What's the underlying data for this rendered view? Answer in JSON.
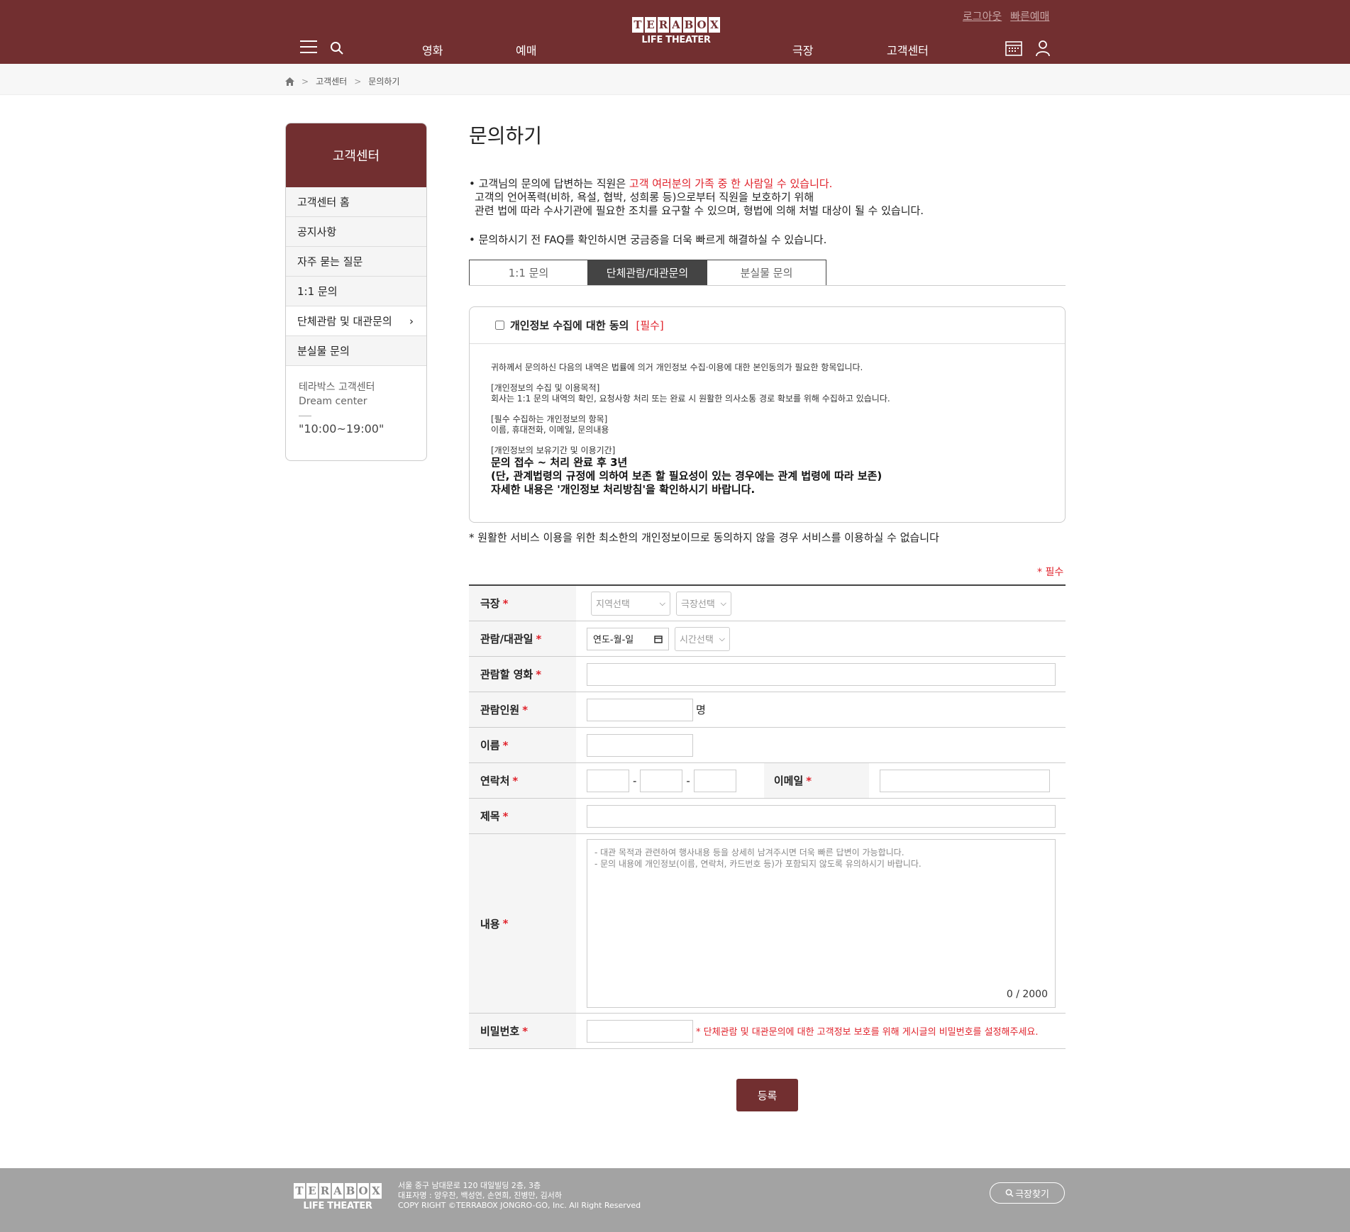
{
  "header": {
    "logo_letters": [
      "T",
      "E",
      "R",
      "A",
      "B",
      "O",
      "X"
    ],
    "logo_sub": "LIFE THEATER",
    "logout": "로그아웃",
    "quick_booking": "빠른예매",
    "nav": [
      "영화",
      "예매",
      "극장",
      "고객센터"
    ],
    "brand_color": "#722f30"
  },
  "breadcrumb": {
    "items": [
      "고객센터",
      "문의하기"
    ]
  },
  "sidebar": {
    "title": "고객센터",
    "items": [
      "고객센터 홈",
      "공지사항",
      "자주 묻는 질문",
      "1:1 문의",
      "단체관람 및 대관문의",
      "분실물 문의"
    ],
    "active_index": 4,
    "info_name": "테라박스 고객센터",
    "info_sub": "Dream center",
    "hours": "\"10:00~19:00\""
  },
  "main": {
    "title": "문의하기",
    "notice_prefix": "• 고객님의 문의에 답변하는 직원은 ",
    "notice_red": "고객 여러분의 가족 중 한 사람일 수 있습니다.",
    "notice_line2": "고객의 언어폭력(비하, 욕설, 협박, 성희롱 등)으로부터 직원을 보호하기 위해",
    "notice_line3": "관련 법에 따라 수사기관에 필요한 조치를 요구할 수 있으며, 형법에 의해 처벌 대상이 될 수 있습니다.",
    "notice_faq": "• 문의하시기 전 FAQ를 확인하시면 궁금증을 더욱 빠르게 해결하실 수 있습니다.",
    "tabs": [
      "1:1 문의",
      "단체관람/대관문의",
      "분실물 문의"
    ],
    "active_tab": 1
  },
  "agreement": {
    "label": "개인정보 수집에 대한 동의",
    "required": "[필수]",
    "intro": "귀하께서 문의하신 다음의 내역은 법률에 의거 개인정보 수집·이용에 대한 본인동의가 필요한 항목입니다.",
    "purpose_title": "[개인정보의 수집 및 이용목적]",
    "purpose_text": "회사는 1:1 문의 내역의 확인, 요청사항 처리 또는 완료 시 원활한 의사소통 경로 확보를 위해 수집하고 있습니다.",
    "items_title": "[필수 수집하는 개인정보의 항목]",
    "items_text": "이름, 휴대전화, 이메일, 문의내용",
    "retention_title": "[개인정보의 보유기간 및 이용기간]",
    "retention_line1": "문의 접수 ~ 처리 완료 후 3년",
    "retention_line2": "(단, 관계법령의 규정에 의하여 보존 할 필요성이 있는 경우에는 관계 법령에 따라 보존)",
    "retention_line3": "자세한 내용은 '개인정보 처리방침'을 확인하시기 바랍니다.",
    "note": "* 원활한 서비스 이용을 위한 최소한의 개인정보이므로 동의하지 않을 경우 서비스를 이용하실 수 없습니다"
  },
  "form": {
    "required_legend": "* 필수",
    "star": "*",
    "theater_label": "극장",
    "region_select": "지역선택",
    "theater_select": "극장선택",
    "date_label": "관람/대관일",
    "date_placeholder": "연도-월-일",
    "time_select": "시간선택",
    "movie_label": "관람할 영화",
    "people_label": "관람인원",
    "people_unit": "명",
    "name_label": "이름",
    "phone_label": "연락처",
    "phone_sep": "-",
    "email_label": "이메일",
    "subject_label": "제목",
    "content_label": "내용",
    "content_placeholder_1": "- 대관 목적과 관련하여 행사내용 등을 상세히 남겨주시면 더욱 빠른 답변이 가능합니다.",
    "content_placeholder_2": "- 문의 내용에 개인정보(이름, 연락처, 카드번호 등)가 포함되지 않도록 유의하시기 바랍니다.",
    "char_count": "0 / 2000",
    "password_label": "비밀번호",
    "password_note": "* 단체관람 및 대관문의에 대한 고객정보 보호를 위해 게시글의 비밀번호를 설정해주세요.",
    "submit": "등록"
  },
  "footer": {
    "address": "서울 중구 남대문로 120 대일빌딩 2층, 3층",
    "ceo": "대표자명 : 양우찬, 백성연, 손연희, 진병만, 김서하",
    "copyright": "COPY RIGHT ©TERRABOX JONGRO-GO, Inc. All Right Reserved",
    "find_theater": "극장찾기"
  }
}
